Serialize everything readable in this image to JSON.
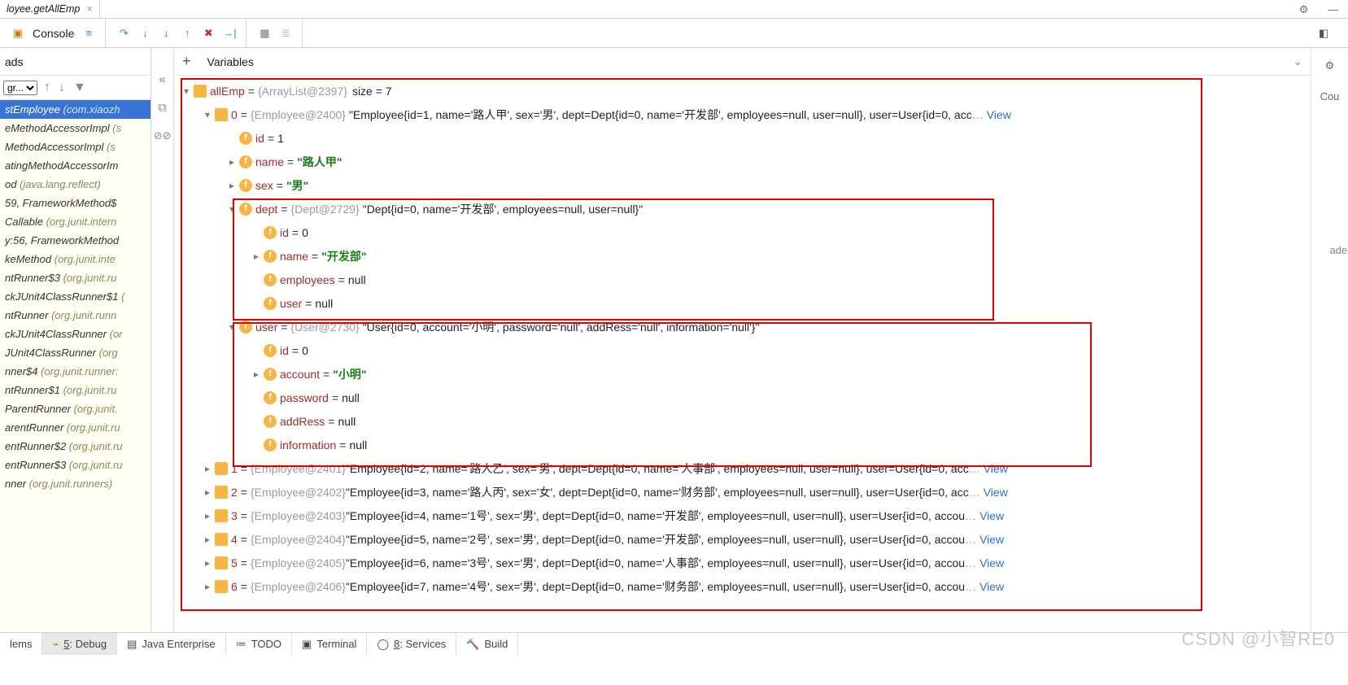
{
  "tab": {
    "label": "loyee.getAllEmp"
  },
  "toolbar": {
    "console": "Console"
  },
  "threads_header": "ads",
  "frames_select": "gr...",
  "frames": [
    {
      "txt": "stEmployee",
      "pkg": "(com.xiaozh",
      "sel": true
    },
    {
      "txt": "eMethodAccessorImpl",
      "pkg": "(s"
    },
    {
      "txt": "MethodAccessorImpl",
      "pkg": "(s"
    },
    {
      "txt": "atingMethodAccessorIm",
      "pkg": ""
    },
    {
      "txt": "od",
      "pkg": "(java.lang.reflect)"
    },
    {
      "txt": "59, FrameworkMethod$",
      "pkg": ""
    },
    {
      "txt": "Callable",
      "pkg": "(org.junit.intern"
    },
    {
      "txt": "y:56, FrameworkMethod",
      "pkg": ""
    },
    {
      "txt": "keMethod",
      "pkg": "(org.junit.inte"
    },
    {
      "txt": "ntRunner$3",
      "pkg": "(org.junit.ru"
    },
    {
      "txt": "ckJUnit4ClassRunner$1",
      "pkg": "("
    },
    {
      "txt": "ntRunner",
      "pkg": "(org.junit.runn"
    },
    {
      "txt": "ckJUnit4ClassRunner",
      "pkg": "(or"
    },
    {
      "txt": "JUnit4ClassRunner",
      "pkg": "(org"
    },
    {
      "txt": "nner$4",
      "pkg": "(org.junit.runner:"
    },
    {
      "txt": "ntRunner$1",
      "pkg": "(org.junit.ru"
    },
    {
      "txt": "ParentRunner",
      "pkg": "(org.junit."
    },
    {
      "txt": "arentRunner",
      "pkg": "(org.junit.ru"
    },
    {
      "txt": "entRunner$2",
      "pkg": "(org.junit.ru"
    },
    {
      "txt": "entRunner$3",
      "pkg": "(org.junit.ru"
    },
    {
      "txt": "nner",
      "pkg": "(org.junit.runners)"
    }
  ],
  "vars_header": "Variables",
  "allEmp": {
    "name": "allEmp",
    "ref": "{ArrayList@2397}",
    "size_lbl": "size = 7"
  },
  "emp0": {
    "idx": "0",
    "ref": "{Employee@2400}",
    "summary": "\"Employee{id=1, name='路人甲', sex='男', dept=Dept{id=0, name='开发部', employees=null, user=null}, user=User{id=0, acc",
    "view": "View",
    "id_k": "id",
    "id_v": "1",
    "name_k": "name",
    "name_v": "\"路人甲\"",
    "sex_k": "sex",
    "sex_v": "\"男\""
  },
  "dept": {
    "k": "dept",
    "ref": "{Dept@2729}",
    "summary": "\"Dept{id=0, name='开发部', employees=null, user=null}\"",
    "id_k": "id",
    "id_v": "0",
    "name_k": "name",
    "name_v": "\"开发部\"",
    "emp_k": "employees",
    "emp_v": "null",
    "user_k": "user",
    "user_v": "null"
  },
  "user": {
    "k": "user",
    "ref": "{User@2730}",
    "summary": "\"User{id=0, account='小明', password='null', addRess='null', information='null'}\"",
    "id_k": "id",
    "id_v": "0",
    "acc_k": "account",
    "acc_v": "\"小明\"",
    "pwd_k": "password",
    "pwd_v": "null",
    "addr_k": "addRess",
    "addr_v": "null",
    "info_k": "information",
    "info_v": "null"
  },
  "rest": [
    {
      "idx": "1",
      "ref": "{Employee@2401}",
      "sum": "\"Employee{id=2, name='路人乙', sex='男', dept=Dept{id=0, name='人事部', employees=null, user=null}, user=User{id=0, acc",
      "view": "View"
    },
    {
      "idx": "2",
      "ref": "{Employee@2402}",
      "sum": "\"Employee{id=3, name='路人丙', sex='女', dept=Dept{id=0, name='财务部', employees=null, user=null}, user=User{id=0, acc",
      "view": "View"
    },
    {
      "idx": "3",
      "ref": "{Employee@2403}",
      "sum": "\"Employee{id=4, name='1号', sex='男', dept=Dept{id=0, name='开发部', employees=null, user=null}, user=User{id=0, accou",
      "view": "View"
    },
    {
      "idx": "4",
      "ref": "{Employee@2404}",
      "sum": "\"Employee{id=5, name='2号', sex='男', dept=Dept{id=0, name='开发部', employees=null, user=null}, user=User{id=0, accou",
      "view": "View"
    },
    {
      "idx": "5",
      "ref": "{Employee@2405}",
      "sum": "\"Employee{id=6, name='3号', sex='男', dept=Dept{id=0, name='人事部', employees=null, user=null}, user=User{id=0, accou",
      "view": "View"
    },
    {
      "idx": "6",
      "ref": "{Employee@2406}",
      "sum": "\"Employee{id=7, name='4号', sex='男', dept=Dept{id=0, name='财务部', employees=null, user=null}, user=User{id=0, accou",
      "view": "View"
    }
  ],
  "right_rail": {
    "cou": "Cou"
  },
  "loaded_hint": "aded. ",
  "status": {
    "problems": "lems",
    "debug": "5: Debug",
    "java_ent": "Java Enterprise",
    "todo": "TODO",
    "terminal": "Terminal",
    "services": "8: Services",
    "build": "Build"
  },
  "watermark": "CSDN @小智RE0"
}
